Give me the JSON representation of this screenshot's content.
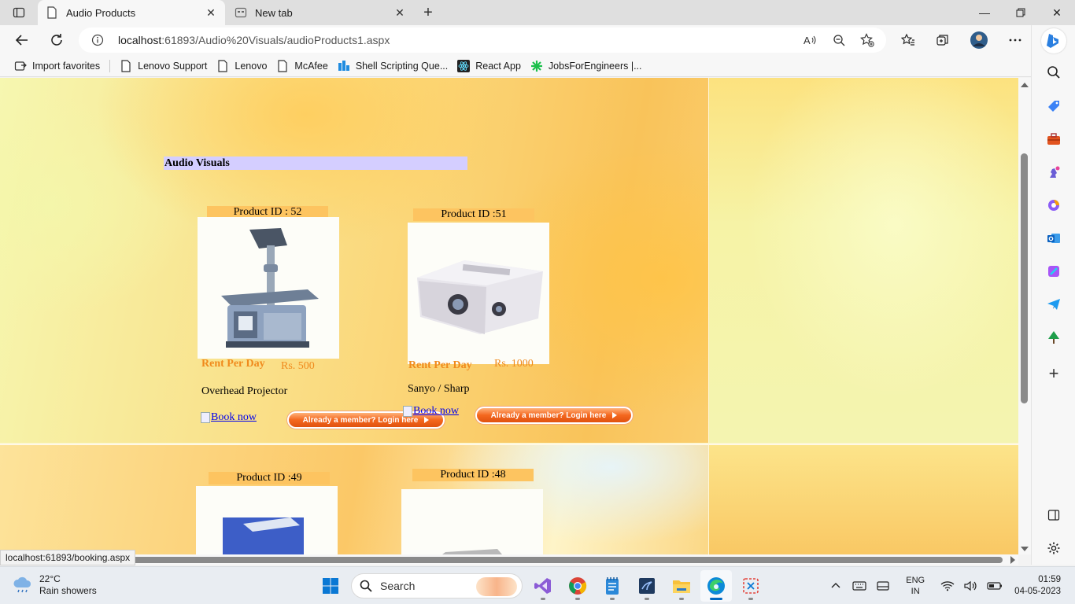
{
  "browser": {
    "tabs": [
      {
        "title": "Audio Products",
        "active": true
      },
      {
        "title": "New tab",
        "active": false
      }
    ],
    "address": {
      "host": "localhost",
      "rest": ":61893/Audio%20Visuals/audioProducts1.aspx"
    },
    "favorites": [
      {
        "label": "Import favorites",
        "icon": "import-icon"
      },
      {
        "label": "Lenovo Support",
        "icon": "page-icon"
      },
      {
        "label": "Lenovo",
        "icon": "page-icon"
      },
      {
        "label": "McAfee",
        "icon": "page-icon"
      },
      {
        "label": "Shell Scripting Que...",
        "icon": "shell-icon"
      },
      {
        "label": "React App",
        "icon": "react-icon"
      },
      {
        "label": "JobsForEngineers |...",
        "icon": "jobs-icon"
      }
    ],
    "status_url": "localhost:61893/booking.aspx"
  },
  "page": {
    "heading": "Audio Visuals",
    "products": [
      {
        "id_label": "Product ID : 52",
        "rent_label": "Rent Per Day",
        "price": "Rs. 500",
        "name": "Overhead Projector",
        "book_label": "Book now",
        "login_label": "Already a member? Login here"
      },
      {
        "id_label": "Product ID :51",
        "rent_label": "Rent Per Day",
        "price": "Rs. 1000",
        "name": "Sanyo / Sharp",
        "book_label": "Book now",
        "login_label": "Already a member? Login here"
      },
      {
        "id_label": "Product ID :49"
      },
      {
        "id_label": "Product ID :48"
      }
    ],
    "colors": {
      "heading_bg": "#d4ceff",
      "product_id_bg": "#fdc460",
      "rent_text": "#f08a1c",
      "link": "#0000ee"
    }
  },
  "taskbar": {
    "weather": {
      "temp": "22°C",
      "condition": "Rain showers"
    },
    "search_placeholder": "Search",
    "language": {
      "line1": "ENG",
      "line2": "IN"
    },
    "clock": {
      "time": "01:59",
      "date": "04-05-2023"
    }
  }
}
